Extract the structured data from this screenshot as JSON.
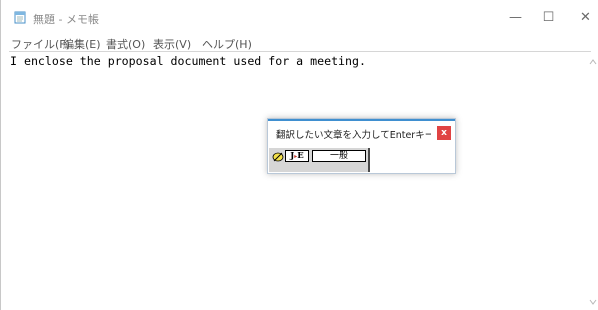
{
  "window": {
    "title": "無題 - メモ帳",
    "controls": {
      "minimize": "—",
      "maximize": "☐",
      "close": "✕"
    }
  },
  "menu": {
    "items": [
      {
        "label": "ファイル(F)"
      },
      {
        "label": "編集(E)"
      },
      {
        "label": "書式(O)"
      },
      {
        "label": "表示(V)"
      },
      {
        "label": "ヘルプ(H)"
      }
    ]
  },
  "editor": {
    "text": "I enclose the proposal document used for a meeting."
  },
  "translate_popup": {
    "title": "翻訳したい文章を入力してEnterキーを...",
    "close_label": "x",
    "direction_label_j": "J",
    "direction_arrow": "▸",
    "direction_label_e": "E",
    "category_label": "一般",
    "accent_color": "#3f8fd0",
    "close_color": "#e04343"
  },
  "icons": {
    "app": "notepad-icon",
    "pencil": "pencil-icon",
    "scroll_up": "scroll-up-arrow-icon",
    "scroll_down": "scroll-down-arrow-icon"
  }
}
